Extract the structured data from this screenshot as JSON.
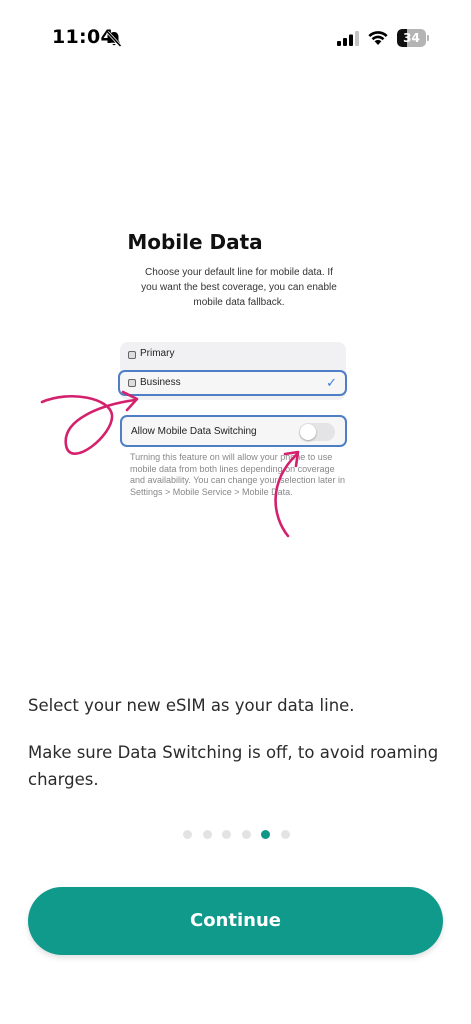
{
  "status_bar": {
    "time": "11:04",
    "battery_level": "34",
    "battery_fraction": 0.34,
    "icons": [
      "bell-slash-icon",
      "cellular-signal-icon",
      "wifi-icon",
      "battery-icon"
    ]
  },
  "illustration": {
    "title": "Mobile Data",
    "description": "Choose your default line for mobile data. If you want the best coverage, you can enable mobile data fallback.",
    "lines": [
      {
        "label": "Primary",
        "selected": false
      },
      {
        "label": "Business",
        "selected": true
      }
    ],
    "check_mark": "✓",
    "switch_label": "Allow Mobile Data Switching",
    "switch_on": false,
    "switch_description": "Turning this feature on will allow your phone to use mobile data from both lines depending on coverage and availability. You can change your selection later in Settings > Mobile Service > Mobile Data.",
    "annotation_color": "#d4216e",
    "highlight_color": "#4e7fc6"
  },
  "instructions": {
    "line1": "Select your new eSIM as your data line.",
    "line2": "Make sure Data Switching is off, to avoid roaming charges."
  },
  "pager": {
    "total": 6,
    "active_index": 4
  },
  "continue_button": {
    "label": "Continue",
    "color": "#0f9a8b"
  }
}
